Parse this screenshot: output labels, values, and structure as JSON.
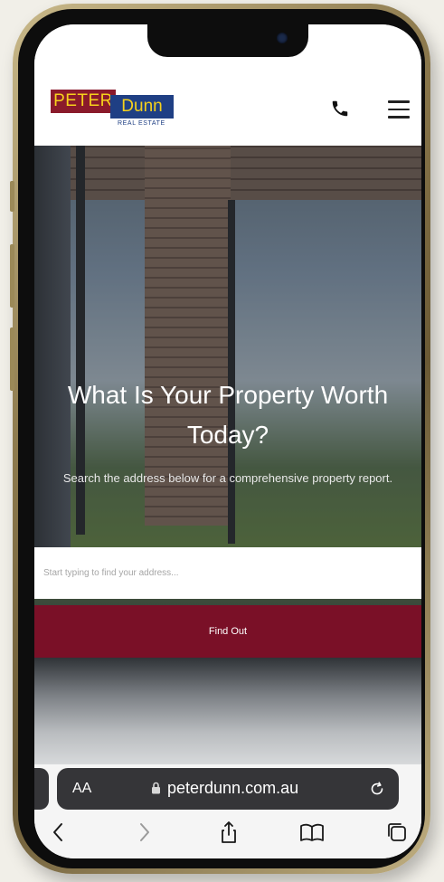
{
  "site": {
    "logo": {
      "peter": "PETER",
      "dunn": "Dunn",
      "sub": "REAL ESTATE"
    },
    "header_icons": [
      "phone-icon",
      "hamburger-menu-icon"
    ]
  },
  "hero": {
    "title": "What Is Your Property Worth Today?",
    "subtitle": "Search the address below for a comprehensive property report.",
    "search_placeholder": "Start typing to find your address...",
    "button_label": "Find Out"
  },
  "browser": {
    "text_size_label": "AA",
    "url": "peterdunn.com.au",
    "toolbar_icons": [
      "back-icon",
      "forward-icon",
      "share-icon",
      "bookmarks-icon",
      "tabs-icon"
    ]
  },
  "colors": {
    "brand_red": "#7a1027",
    "logo_red": "#8a1a2b",
    "logo_blue": "#1f3f84",
    "logo_yellow": "#f6d11c",
    "url_bar": "#353538"
  }
}
